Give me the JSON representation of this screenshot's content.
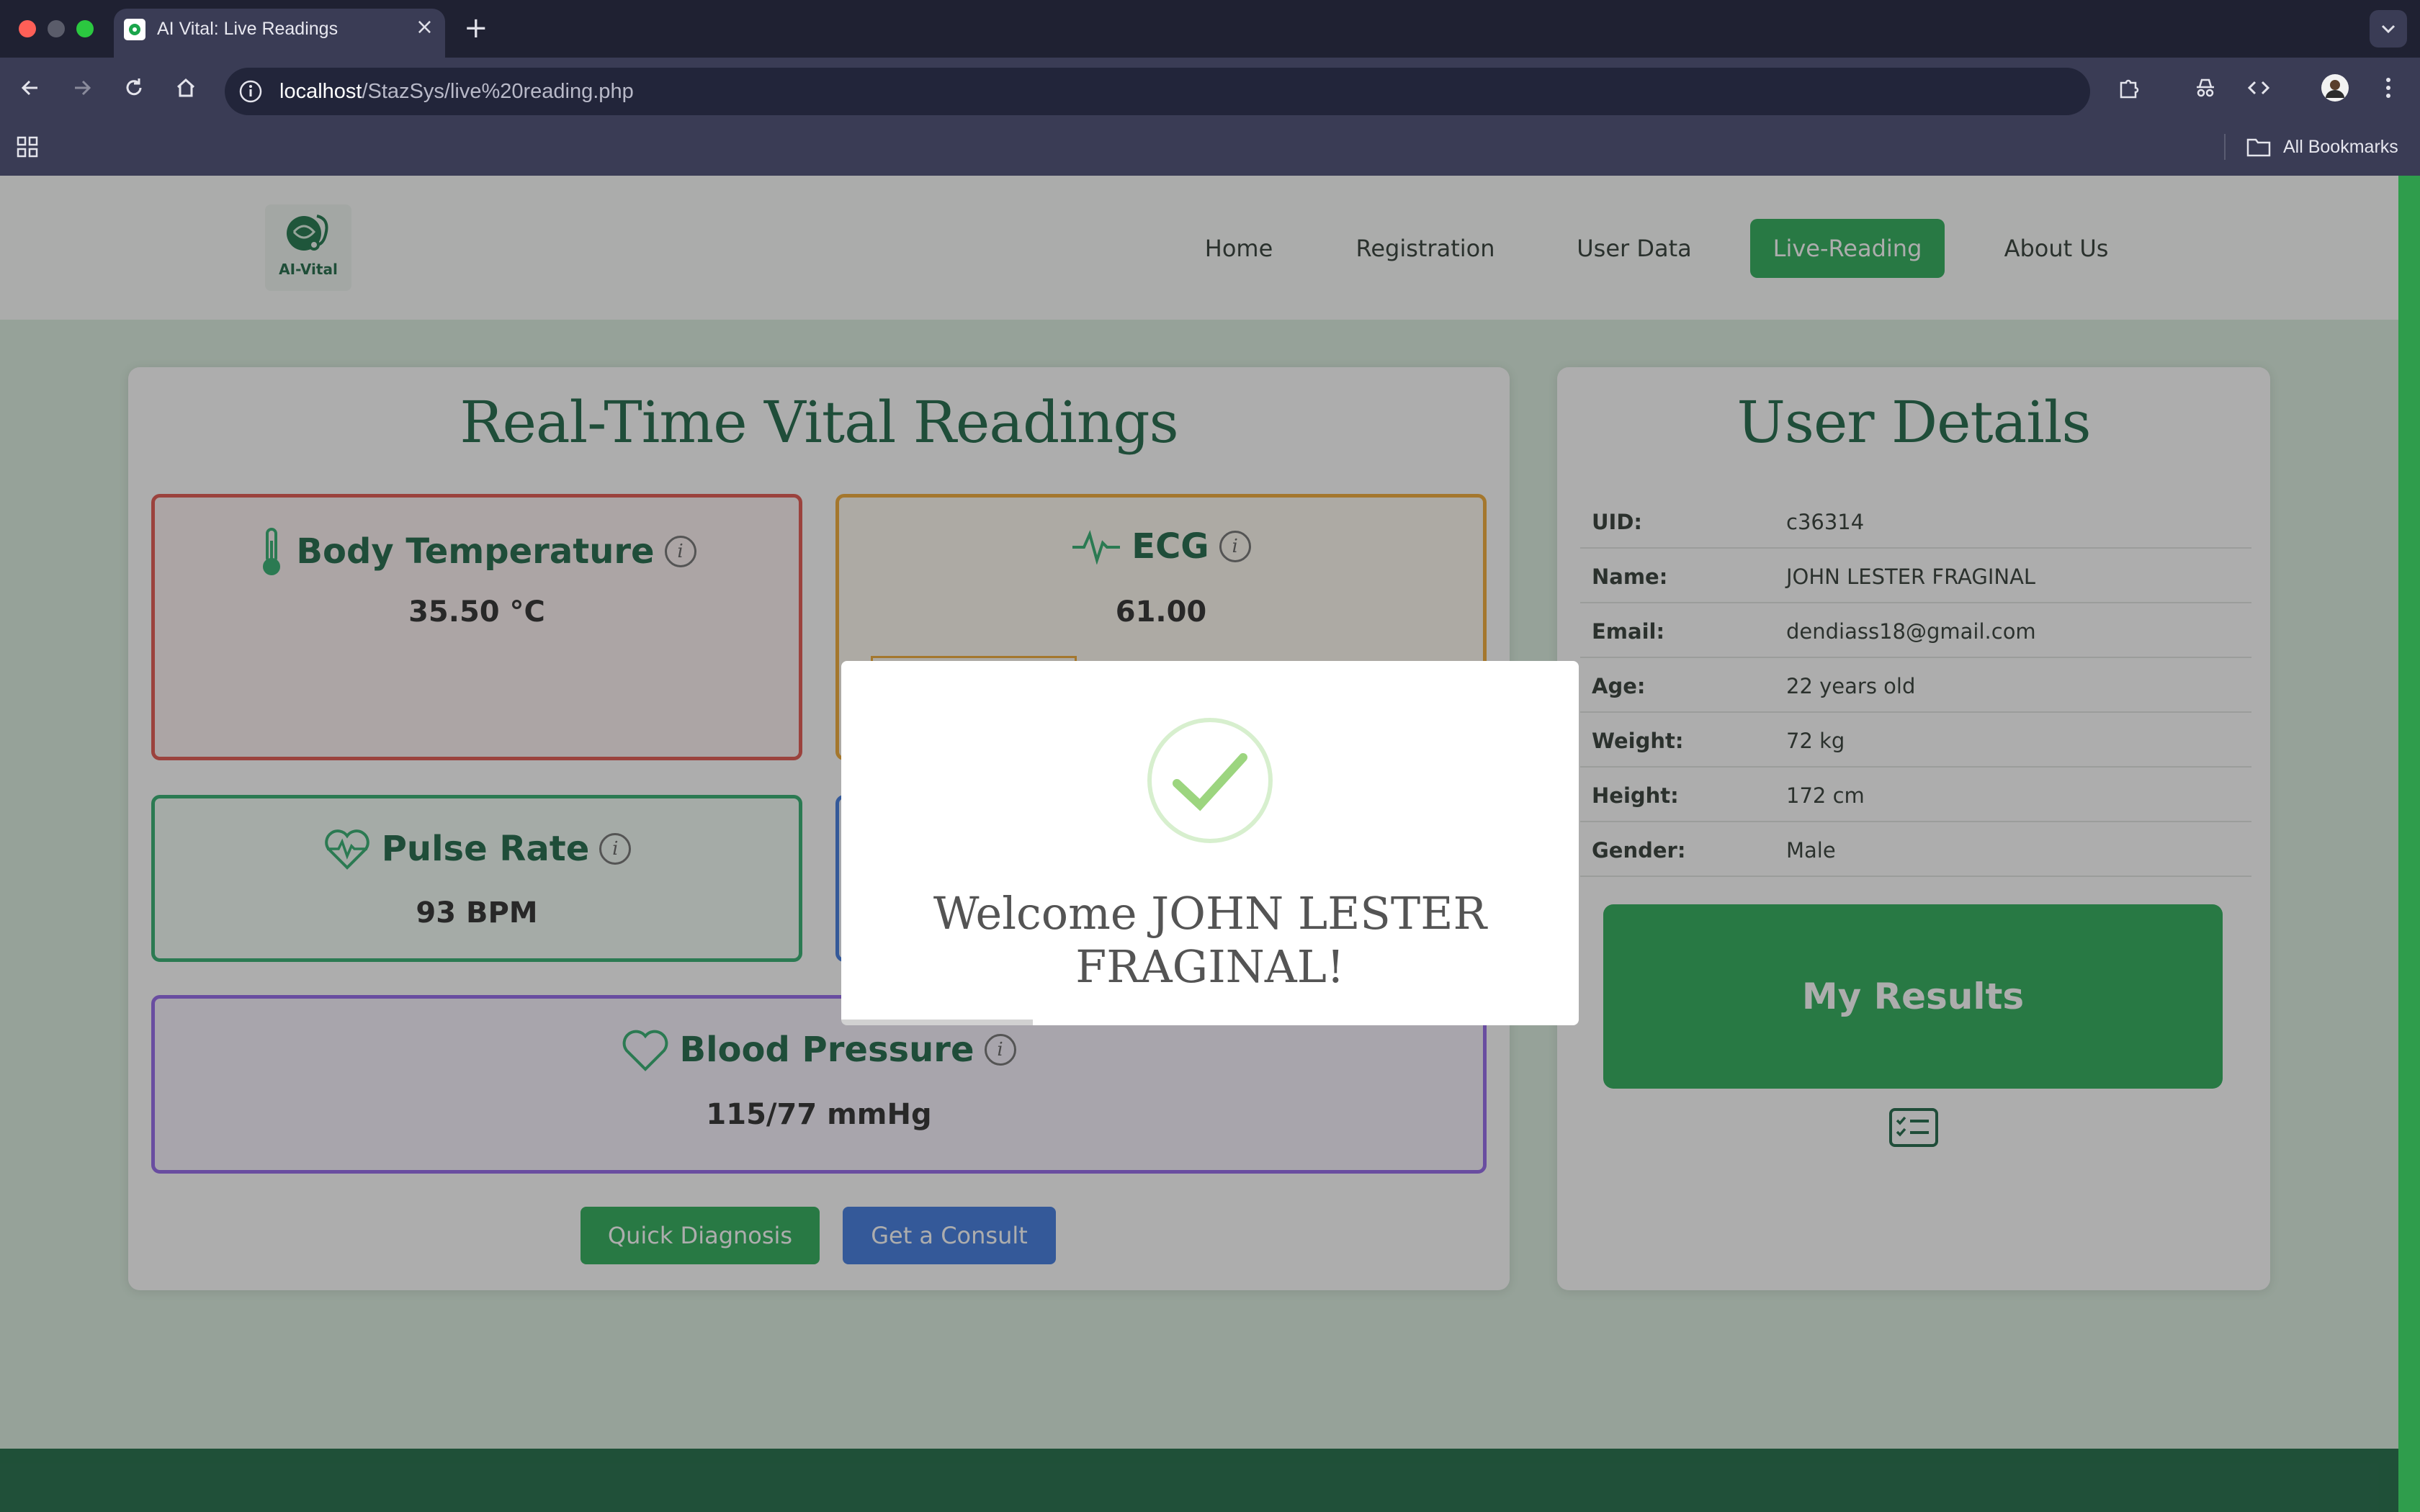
{
  "browser": {
    "tab_title": "AI Vital: Live Readings",
    "tab_close": "×",
    "new_tab": "+",
    "url_host": "localhost",
    "url_path": "/StazSys/live%20reading.php",
    "bookmarks_label": "All Bookmarks"
  },
  "site": {
    "logo_text": "AI-Vital",
    "nav": [
      {
        "label": "Home"
      },
      {
        "label": "Registration"
      },
      {
        "label": "User Data"
      },
      {
        "label": "Live-Reading",
        "active": true
      },
      {
        "label": "About Us"
      }
    ]
  },
  "vitals": {
    "title": "Real-Time Vital Readings",
    "body_temperature": {
      "label": "Body Temperature",
      "value": "35.50 °C",
      "color": "#e0483f"
    },
    "ecg": {
      "label": "ECG",
      "value": "61.00",
      "color": "#f0a324"
    },
    "pulse": {
      "label": "Pulse Rate",
      "value": "93 BPM",
      "color": "#1fa763"
    },
    "blood_pressure": {
      "label": "Blood Pressure",
      "value": "115/77 mmHg",
      "color": "#8b5ae8"
    },
    "info_glyph": "i",
    "buttons": {
      "quick_diagnosis": "Quick Diagnosis",
      "get_consult": "Get a Consult"
    }
  },
  "user_details": {
    "title": "User Details",
    "rows": [
      {
        "label": "UID:",
        "value": "c36314"
      },
      {
        "label": "Name:",
        "value": "JOHN LESTER FRAGINAL"
      },
      {
        "label": "Email:",
        "value": "dendiass18@gmail.com"
      },
      {
        "label": "Age:",
        "value": "22 years old"
      },
      {
        "label": "Weight:",
        "value": "72 kg"
      },
      {
        "label": "Height:",
        "value": "172 cm"
      },
      {
        "label": "Gender:",
        "value": "Male"
      }
    ],
    "results_button": "My Results"
  },
  "modal": {
    "message": "Welcome JOHN LESTER FRAGINAL!",
    "timer_progress": 0.26
  },
  "colors": {
    "brand_green": "#1aa54b",
    "dark_green": "#0c5a37",
    "consult_blue": "#2f6fdc"
  }
}
